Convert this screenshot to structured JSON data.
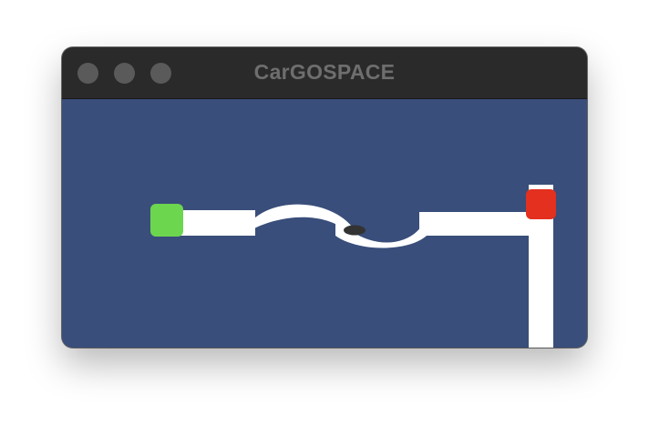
{
  "window": {
    "title": "CarGOSPACE"
  },
  "colors": {
    "titlebar": "#2a2a2a",
    "title_text": "#6e6e6e",
    "traffic_light": "#5a5a5a",
    "background": "#394e7a",
    "road": "#ffffff",
    "start_marker": "#6cd64f",
    "goal_marker": "#e3301f",
    "car": "#333333"
  },
  "icons": {
    "start": "green-square-start-marker",
    "goal": "red-square-goal-marker",
    "car": "car-icon"
  }
}
